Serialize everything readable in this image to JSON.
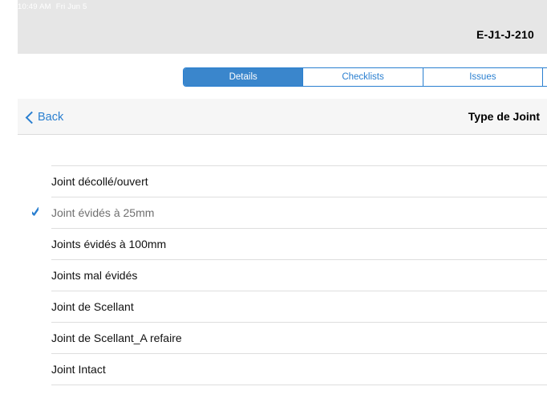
{
  "status_bar": {
    "time": "10:49 AM",
    "date": "Fri Jun 5"
  },
  "header": {
    "title": "E-J1-J-210"
  },
  "tabs": [
    {
      "label": "Details",
      "active": true
    },
    {
      "label": "Checklists",
      "active": false
    },
    {
      "label": "Issues",
      "active": false
    },
    {
      "label": "",
      "active": false
    }
  ],
  "nav": {
    "back_label": "Back",
    "title": "Type de Joint"
  },
  "options": [
    {
      "label": "Joint décollé/ouvert",
      "selected": false
    },
    {
      "label": "Joint évidés à 25mm",
      "selected": true
    },
    {
      "label": "Joints évidés à 100mm",
      "selected": false
    },
    {
      "label": "Joints mal évidés",
      "selected": false
    },
    {
      "label": "Joint de Scellant",
      "selected": false
    },
    {
      "label": "Joint de Scellant_A refaire",
      "selected": false
    },
    {
      "label": "Joint Intact",
      "selected": false
    }
  ],
  "colors": {
    "accent": "#2a7fd0",
    "segment_active": "#3a86cc",
    "header_bg": "#e6e6e6"
  }
}
